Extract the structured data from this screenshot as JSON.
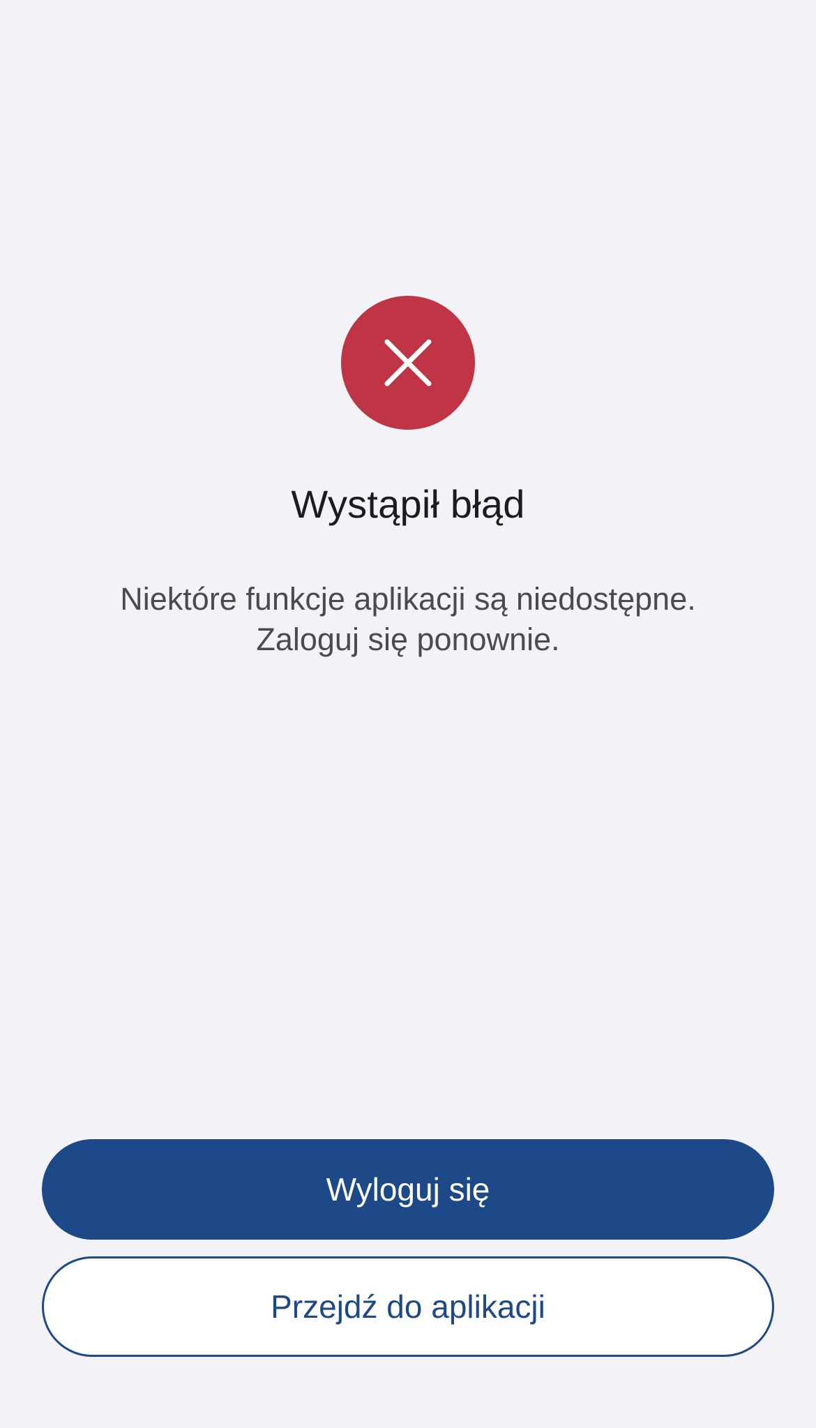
{
  "error": {
    "icon": "close-icon",
    "color": "#c03545",
    "title": "Wystąpił błąd",
    "message_lines": [
      "Niektóre funkcje aplikacji są niedostępne.",
      "Zaloguj się ponownie."
    ]
  },
  "actions": {
    "logout_label": "Wyloguj się",
    "go_to_app_label": "Przejdź do aplikacji"
  },
  "colors": {
    "background": "#f2f2f7",
    "accent": "#1d4989",
    "error": "#c03545"
  }
}
